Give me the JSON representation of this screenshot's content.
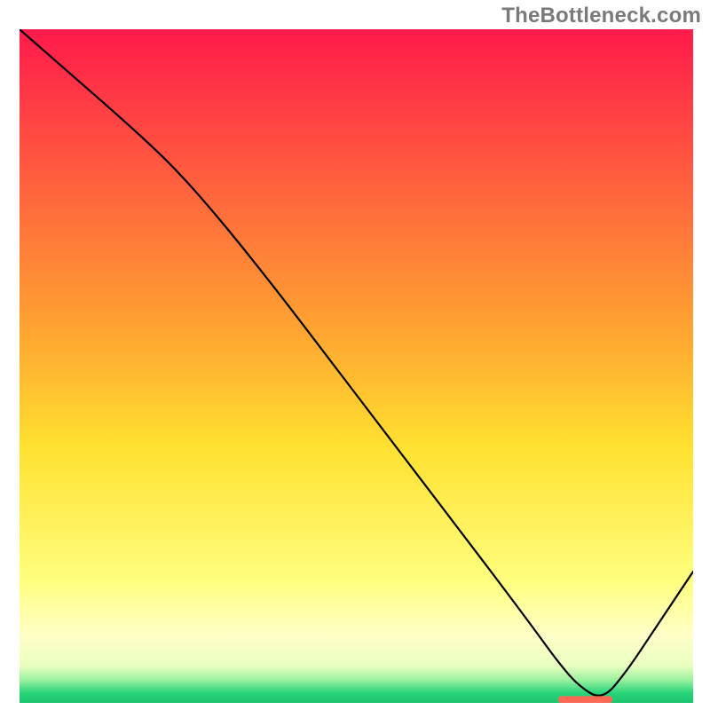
{
  "watermark": {
    "text": "TheBottleneck.com"
  },
  "chart_data": {
    "type": "line",
    "title": "",
    "xlabel": "",
    "ylabel": "",
    "xlim": [
      0,
      100
    ],
    "ylim": [
      0,
      100
    ],
    "grid": false,
    "legend": null,
    "background_gradient": {
      "stops": [
        {
          "offset": 0.0,
          "color": "#ff1a4b"
        },
        {
          "offset": 0.45,
          "color": "#ffa531"
        },
        {
          "offset": 0.62,
          "color": "#ffe130"
        },
        {
          "offset": 0.82,
          "color": "#ffff80"
        },
        {
          "offset": 0.9,
          "color": "#ffffc8"
        },
        {
          "offset": 0.945,
          "color": "#e9ffc0"
        },
        {
          "offset": 0.965,
          "color": "#9ff2a0"
        },
        {
          "offset": 0.985,
          "color": "#2ad47a"
        },
        {
          "offset": 1.0,
          "color": "#1bc46e"
        }
      ]
    },
    "series": [
      {
        "name": "bottleneck-curve",
        "color": "#000000",
        "x": [
          0.0,
          8.0,
          16.0,
          23.0,
          30.0,
          38.0,
          46.0,
          54.0,
          62.0,
          70.0,
          76.0,
          80.0,
          83.0,
          86.5,
          90.0,
          94.0,
          100.0
        ],
        "y": [
          100.0,
          93.0,
          86.0,
          79.5,
          71.5,
          61.5,
          51.0,
          40.5,
          30.0,
          19.5,
          11.5,
          6.0,
          2.5,
          0.4,
          4.5,
          10.5,
          19.5
        ]
      }
    ],
    "markers": [
      {
        "name": "optimal-range",
        "shape": "rounded-rect",
        "color": "#ff6a55",
        "x_start": 80.0,
        "x_end": 88.0,
        "y": 0.5,
        "height": 1.0
      }
    ]
  }
}
